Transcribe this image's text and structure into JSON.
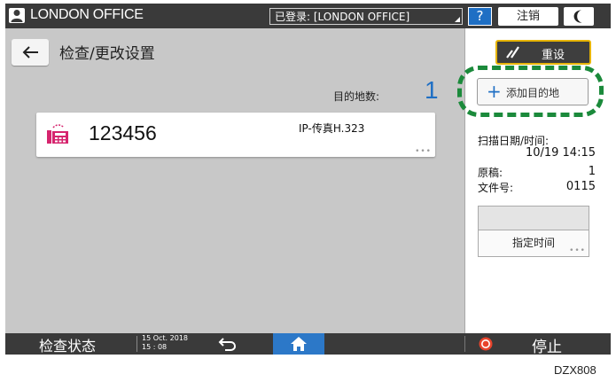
{
  "topbar": {
    "user_name": "LONDON OFFICE",
    "login_status": "已登录: [LONDON OFFICE]",
    "help_label": "?",
    "logout_label": "注销"
  },
  "header": {
    "title": "检查/更改设置"
  },
  "side": {
    "reset_label": "重设",
    "add_destination_label": "添加目的地",
    "scan_datetime_label": "扫描日期/时间:",
    "scan_datetime_value": "10/19 14:15",
    "originals_label": "原稿:",
    "originals_value": "1",
    "file_no_label": "文件号:",
    "file_no_value": "0115",
    "schedule_label": "指定时间"
  },
  "destinations": {
    "count_label": "目的地数:",
    "count": "1",
    "items": [
      {
        "number": "123456",
        "type": "IP-传真H.323"
      }
    ]
  },
  "bottombar": {
    "status_label": "检查状态",
    "date_line1": "15 Oct. 2018",
    "date_line2": "15 : 08",
    "stop_label": "停止"
  },
  "footer_code": "DZX808",
  "colors": {
    "accent": "#1f6fc4",
    "highlight": "#1b8a3b",
    "reset_border": "#e6b400",
    "fax_icon": "#d6246e",
    "stop": "#e8442c"
  }
}
